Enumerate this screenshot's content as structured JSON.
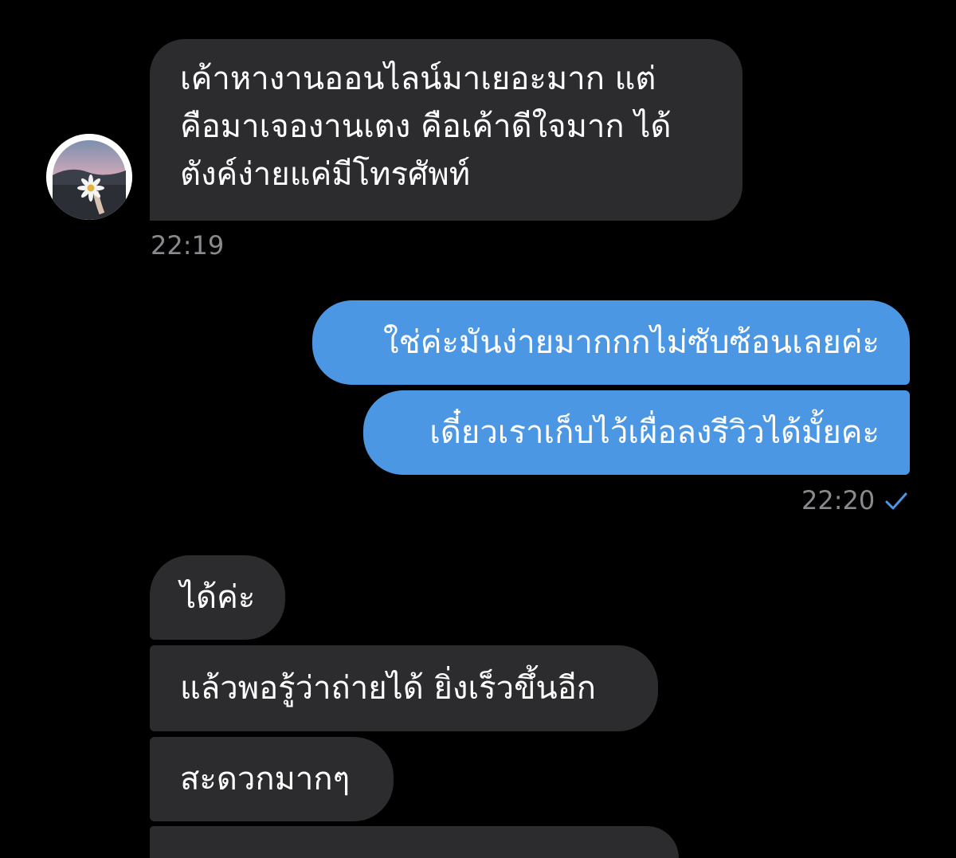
{
  "conversation": {
    "received_1": {
      "lines": [
        "เค้าหางานออนไลน์มาเยอะมาก แต่",
        "คือมาเจองานเตง คือเค้าดีใจมาก ได้",
        "ตังค์ง่ายแค่มีโทรศัพท์"
      ],
      "time": "22:19"
    },
    "sent": {
      "messages": [
        "ใช่ค่ะมันง่ายมากกกไม่ซับซ้อนเลยค่ะ",
        "เดี๋ยวเราเก็บไว้เผื่อลงรีวิวได้มั้ยคะ"
      ],
      "time": "22:20",
      "status_icon": "single-checkmark-icon"
    },
    "received_2": {
      "messages": [
        "ได้ค่ะ",
        "แล้วพอรู้ว่าถ่ายได้ ยิ่งเร็วขึ้นอีก",
        "สะดวกมากๆ"
      ]
    }
  },
  "colors": {
    "background": "#000000",
    "incoming_bubble": "#2c2c2e",
    "outgoing_bubble": "#4b97e4",
    "timestamp": "#8a8a8e",
    "checkmark": "#4b97e4"
  },
  "avatar": {
    "icon": "contact-avatar-daisy-photo"
  }
}
